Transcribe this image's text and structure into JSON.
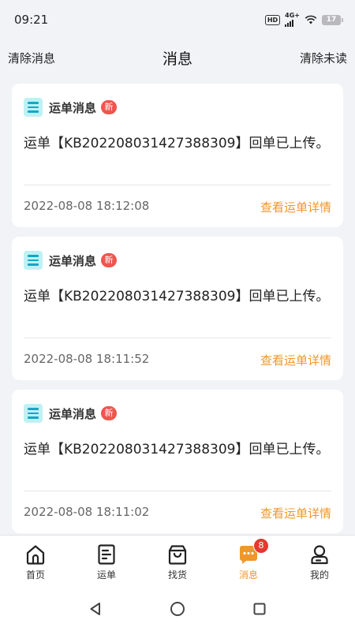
{
  "status_bar": {
    "time": "09:21",
    "hd": "HD",
    "network": "4G+",
    "battery": "17"
  },
  "header": {
    "clear_all_label": "清除消息",
    "title": "消息",
    "clear_unread_label": "清除未读"
  },
  "messages": [
    {
      "type": "运单消息",
      "badge": "新",
      "content": "运单【KB202208031427388309】回单已上传。",
      "time": "2022-08-08 18:12:08",
      "link": "查看运单详情"
    },
    {
      "type": "运单消息",
      "badge": "新",
      "content": "运单【KB202208031427388309】回单已上传。",
      "time": "2022-08-08 18:11:52",
      "link": "查看运单详情"
    },
    {
      "type": "运单消息",
      "badge": "新",
      "content": "运单【KB202208031427388309】回单已上传。",
      "time": "2022-08-08 18:11:02",
      "link": "查看运单详情"
    }
  ],
  "tabs": [
    {
      "label": "首页",
      "icon": "home-icon"
    },
    {
      "label": "运单",
      "icon": "waybill-icon"
    },
    {
      "label": "找货",
      "icon": "find-cargo-icon"
    },
    {
      "label": "消息",
      "icon": "message-icon",
      "badge": "8",
      "active": true
    },
    {
      "label": "我的",
      "icon": "profile-icon"
    }
  ],
  "colors": {
    "accent": "#f0962b",
    "badge": "#f0554d",
    "message_icon_bg": "#bff1f4",
    "message_icon_fg": "#16a6c4",
    "background": "#f2f3f7"
  },
  "nav_bar": {
    "back": "back-icon",
    "home": "home-circle-icon",
    "recents": "recents-icon"
  }
}
